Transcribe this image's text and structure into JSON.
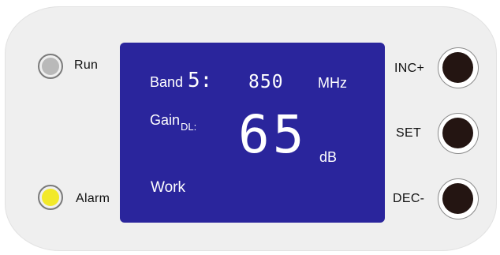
{
  "indicators": [
    {
      "label": "Run",
      "color": "#b9b9b9"
    },
    {
      "label": "Alarm",
      "color": "#f2e92a"
    }
  ],
  "display": {
    "band_label": "Band",
    "band_number": "5:",
    "band_value": "850",
    "band_unit": "MHz",
    "gain_label": "Gain",
    "gain_subscript": "DL:",
    "gain_value": "65",
    "gain_unit": "dB",
    "status": "Work",
    "background_color": "#2a259c"
  },
  "buttons": [
    {
      "label": "INC+",
      "icon": "round-push-button"
    },
    {
      "label": "SET",
      "icon": "round-push-button"
    },
    {
      "label": "DEC-",
      "icon": "round-push-button"
    }
  ]
}
